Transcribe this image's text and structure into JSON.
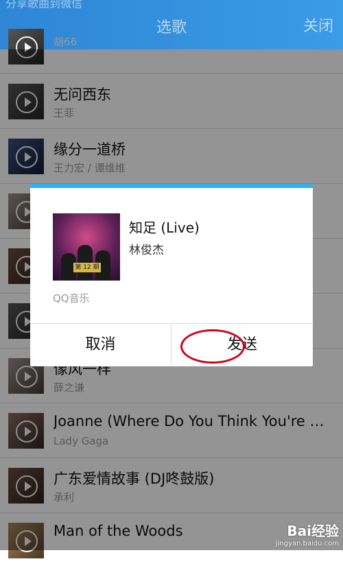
{
  "header": {
    "faded_text": "分享歌曲到微信",
    "title": "选歌",
    "close_label": "关闭"
  },
  "songs": [
    {
      "title": "",
      "artist": "胡66"
    },
    {
      "title": "无问西东",
      "artist": "王菲"
    },
    {
      "title": "缘分一道桥",
      "artist": "王力宏 / 谭维维"
    },
    {
      "title": "",
      "artist": ""
    },
    {
      "title": "",
      "artist": ""
    },
    {
      "title": "",
      "artist": ""
    },
    {
      "title": "像风一样",
      "artist": "薛之谦"
    },
    {
      "title": "Joanne (Where Do You Think You're Goi...",
      "artist": "Lady Gaga"
    },
    {
      "title": "广东爱情故事 (DJ咚鼓版)",
      "artist": "承利"
    },
    {
      "title": "Man of the Woods",
      "artist": ""
    }
  ],
  "dialog": {
    "song_title": "知足 (Live)",
    "artist": "林俊杰",
    "source": "QQ音乐",
    "cover_badge": "第 12 期",
    "cancel_label": "取消",
    "send_label": "发送",
    "accent_color": "#30b2e8",
    "highlight_color": "#d0021b"
  },
  "watermark": {
    "logo": "Bai经验",
    "site": "jingyan.baidu.com"
  }
}
